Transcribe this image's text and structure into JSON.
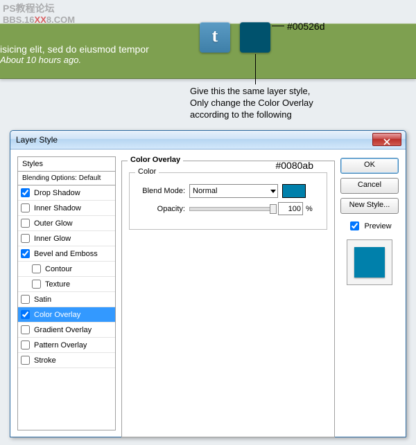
{
  "watermark": {
    "line1": "PS教程论坛",
    "line2a": "BBS.16",
    "line2b": "XX",
    "line2c": "8.COM"
  },
  "banner": {
    "text": "isicing elit, sed do eiusmod tempor",
    "ago": "About 10 hours ago."
  },
  "twitter_glyph": "t",
  "hex1": "#00526d",
  "note": {
    "l1": "Give this the same layer style,",
    "l2": "Only change the Color Overlay",
    "l3": "according to the following"
  },
  "dialog": {
    "title": "Layer Style",
    "styles_header": "Styles",
    "blending": "Blending Options: Default",
    "rows": {
      "drop_shadow": "Drop Shadow",
      "inner_shadow": "Inner Shadow",
      "outer_glow": "Outer Glow",
      "inner_glow": "Inner Glow",
      "bevel": "Bevel and Emboss",
      "contour": "Contour",
      "texture": "Texture",
      "satin": "Satin",
      "color_overlay": "Color Overlay",
      "gradient_overlay": "Gradient Overlay",
      "pattern_overlay": "Pattern Overlay",
      "stroke": "Stroke"
    },
    "center": {
      "title": "Color Overlay",
      "color_group": "Color",
      "blend_mode_label": "Blend Mode:",
      "blend_mode_value": "Normal",
      "opacity_label": "Opacity:",
      "opacity_value": "100",
      "opacity_unit": "%",
      "hex2": "#0080ab"
    },
    "right": {
      "ok": "OK",
      "cancel": "Cancel",
      "new_style": "New Style...",
      "preview": "Preview"
    }
  }
}
